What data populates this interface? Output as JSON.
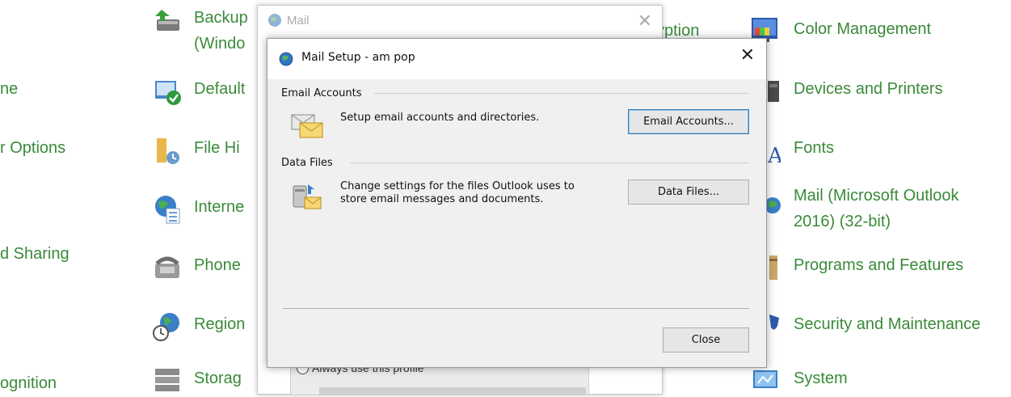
{
  "control_panel": {
    "left_col": [
      "ne",
      "r Options",
      "d Sharing",
      "ognition"
    ],
    "mid_col": [
      {
        "label_line1": "Backup",
        "label_line2": "(Windo",
        "icon": "backup-icon"
      },
      {
        "label": "Default",
        "icon": "default-programs-icon"
      },
      {
        "label": "File Hi",
        "icon": "file-history-icon"
      },
      {
        "label": "Interne",
        "icon": "internet-options-icon"
      },
      {
        "label": "Phone",
        "icon": "phone-modem-icon"
      },
      {
        "label": "Region",
        "icon": "region-icon"
      },
      {
        "label": "Storag",
        "icon": "storage-spaces-icon"
      }
    ],
    "right_col": [
      {
        "label": "Color Management",
        "icon": "color-management-icon"
      },
      {
        "label": "Devices and Printers",
        "icon": "devices-printers-icon"
      },
      {
        "label": "Fonts",
        "icon": "fonts-icon"
      },
      {
        "label_line1": "Mail (Microsoft Outlook",
        "label_line2": "2016) (32-bit)",
        "icon": "mail-icon"
      },
      {
        "label": "Programs and Features",
        "icon": "programs-features-icon"
      },
      {
        "label": "Security and Maintenance",
        "icon": "security-maintenance-icon"
      },
      {
        "label": "System",
        "icon": "system-icon"
      }
    ],
    "partial_behind": "yption"
  },
  "mail_window": {
    "title": "Mail",
    "close_glyph": "✕",
    "always_use_profile": "Always use this profile"
  },
  "setup_dialog": {
    "title": "Mail Setup - am pop",
    "close_glyph": "✕",
    "email_accounts": {
      "group_label": "Email Accounts",
      "description": "Setup email accounts and directories.",
      "button": "Email Accounts..."
    },
    "data_files": {
      "group_label": "Data Files",
      "description_line1": "Change settings for the files Outlook uses to",
      "description_line2": "store email messages and documents.",
      "button": "Data Files..."
    },
    "close_button": "Close"
  }
}
